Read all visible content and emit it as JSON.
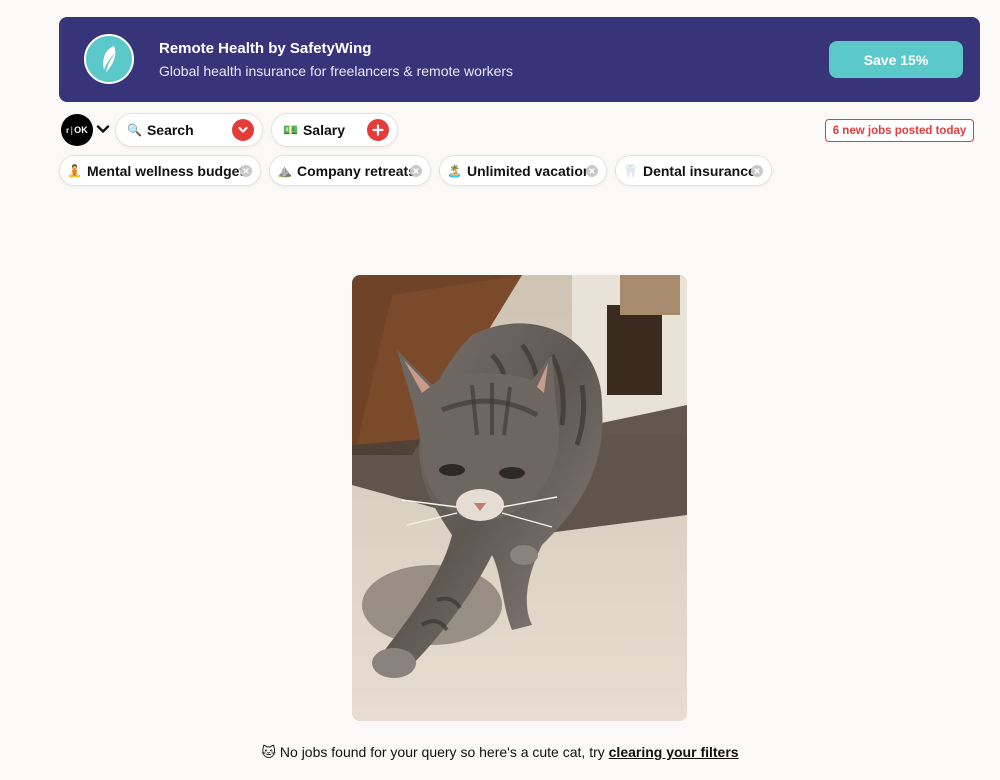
{
  "banner": {
    "title": "Remote Health by SafetyWing",
    "subtitle": "Global health insurance for freelancers & remote workers",
    "cta_label": "Save 15%",
    "logo_icon": "feather-icon",
    "bg_color": "#38347a",
    "accent_color": "#5bc8c9"
  },
  "toolbar": {
    "brand_label": "OK",
    "search": {
      "emoji": "🔍",
      "label": "Search",
      "icon": "chevron-down-icon"
    },
    "salary": {
      "emoji": "💵",
      "label": "Salary",
      "icon": "plus-icon"
    },
    "new_jobs_label": "6 new jobs posted today"
  },
  "filters": [
    {
      "emoji": "🧘",
      "label": "Mental wellness budget"
    },
    {
      "emoji": "⛰️",
      "label": "Company retreats"
    },
    {
      "emoji": "🏝️",
      "label": "Unlimited vacation"
    },
    {
      "emoji": "🦷",
      "label": "Dental insurance"
    }
  ],
  "empty_state": {
    "emoji": "🐱",
    "message": " No jobs found for your query so here's a cute cat, try ",
    "link_label": "clearing your filters"
  },
  "colors": {
    "red": "#e53b3b",
    "background": "#faf9f7"
  }
}
